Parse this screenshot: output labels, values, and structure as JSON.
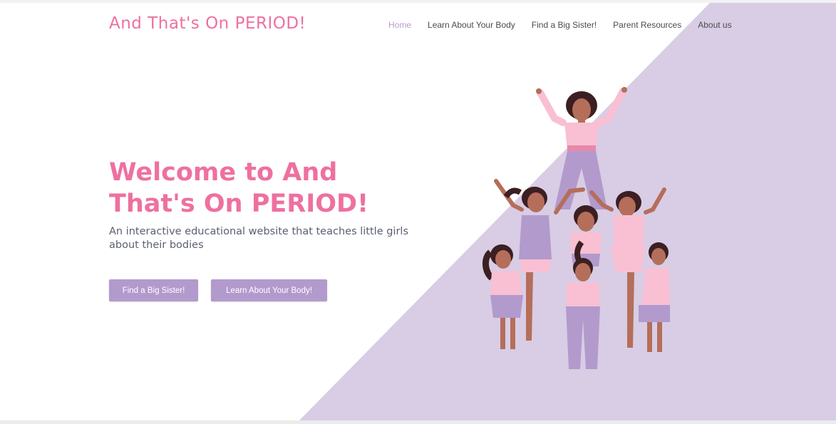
{
  "site": {
    "brand": "And That's On PERIOD!"
  },
  "nav": {
    "items": [
      {
        "label": "Home",
        "active": true
      },
      {
        "label": "Learn About Your Body",
        "active": false
      },
      {
        "label": "Find a Big Sister!",
        "active": false
      },
      {
        "label": "Parent Resources",
        "active": false
      },
      {
        "label": "About us",
        "active": false
      }
    ]
  },
  "hero": {
    "title_line1": "Welcome to And",
    "title_line2": "That's On PERIOD!",
    "subtitle": "An interactive educational website that teaches little girls about their bodies",
    "buttons": {
      "primary": "Find a Big Sister!",
      "secondary": "Learn About Your Body!"
    },
    "illustration": "group-of-girls-pyramid-illustration"
  },
  "colors": {
    "brand_pink": "#ee70a0",
    "lavender": "#d8cde4",
    "button_purple": "#b29acd",
    "nav_active": "#b79bcd",
    "text_gray": "#5a5f73"
  }
}
